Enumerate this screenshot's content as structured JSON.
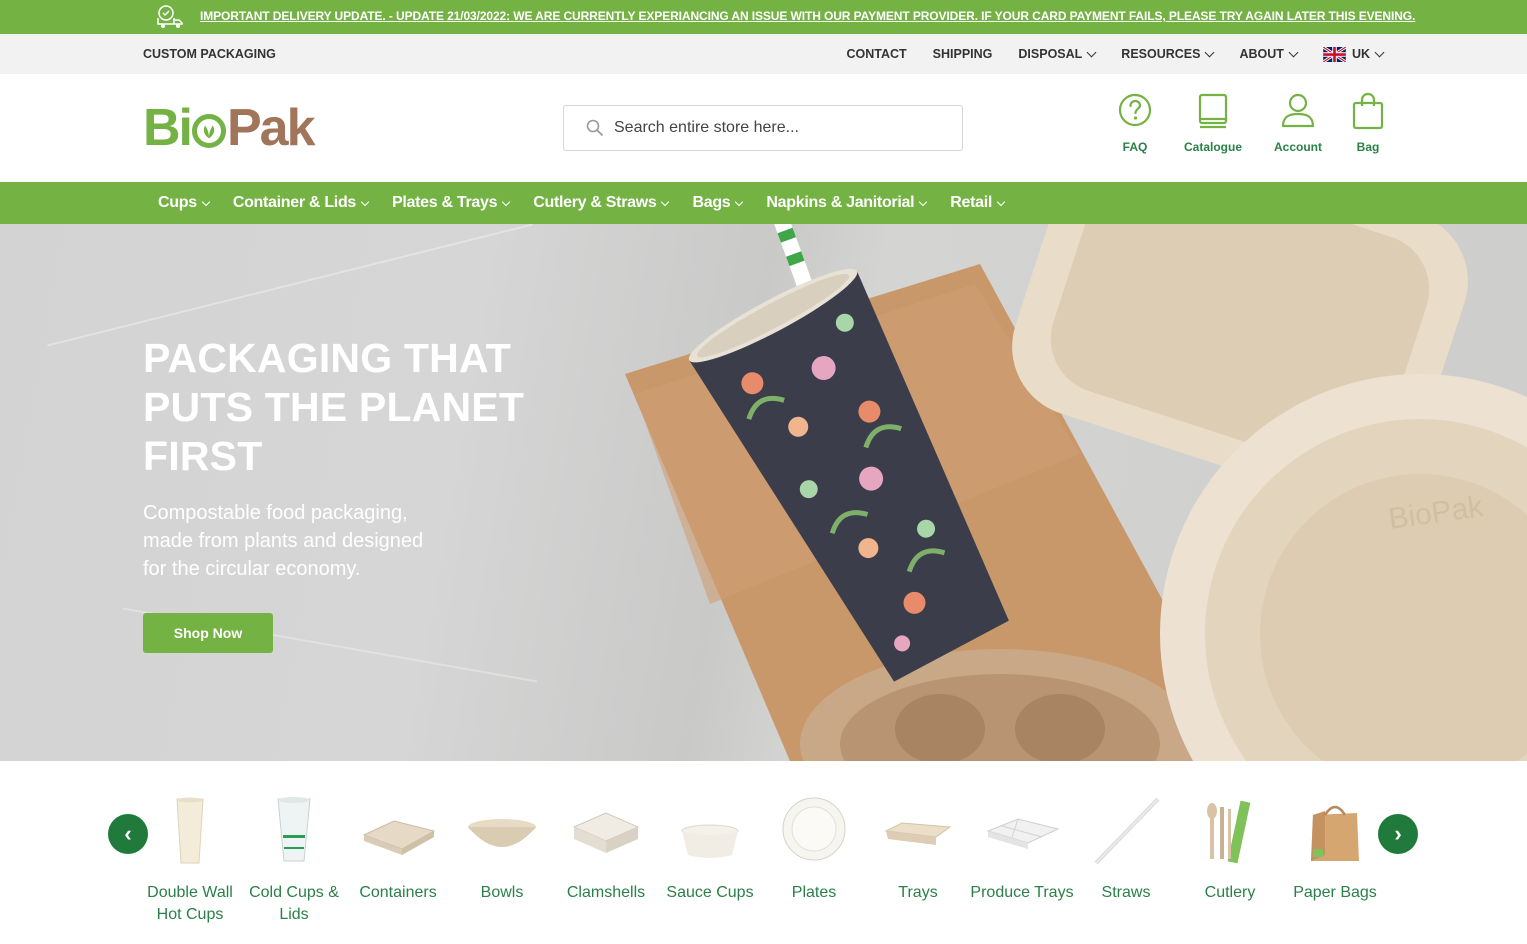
{
  "announcement": {
    "text": "IMPORTANT DELIVERY UPDATE. - UPDATE 21/03/2022: WE ARE CURRENTLY EXPERIANCING AN ISSUE WITH OUR PAYMENT PROVIDER. IF YOUR CARD PAYMENT FAILS, PLEASE TRY AGAIN LATER THIS EVENING.",
    "icon": "delivery-truck-icon"
  },
  "utility": {
    "custom_packaging": "CUSTOM PACKAGING",
    "links": [
      "CONTACT",
      "SHIPPING",
      "DISPOSAL",
      "RESOURCES",
      "ABOUT"
    ],
    "region": "UK"
  },
  "header": {
    "logo_left": "Bi",
    "logo_right": "Pak",
    "search_placeholder": "Search entire store here...",
    "icons": [
      {
        "label": "FAQ",
        "icon": "question-circle-icon"
      },
      {
        "label": "Catalogue",
        "icon": "book-icon"
      },
      {
        "label": "Account",
        "icon": "user-icon"
      },
      {
        "label": "Bag",
        "icon": "shopping-bag-icon"
      }
    ]
  },
  "categories": [
    "Cups",
    "Container & Lids",
    "Plates & Trays",
    "Cutlery & Straws",
    "Bags",
    "Napkins & Janitorial",
    "Retail"
  ],
  "hero": {
    "title": "PACKAGING THAT PUTS THE PLANET FIRST",
    "subtitle": "Compostable food packaging, made from plants and designed for the circular economy.",
    "button": "Shop Now"
  },
  "carousel": {
    "prev": "‹",
    "next": "›",
    "items": [
      "Double Wall Hot Cups",
      "Cold Cups & Lids",
      "Containers",
      "Bowls",
      "Clamshells",
      "Sauce Cups",
      "Plates",
      "Trays",
      "Produce Trays",
      "Straws",
      "Cutlery",
      "Paper Bags"
    ]
  },
  "colors": {
    "brand_green": "#74b244",
    "dark_green": "#1f7a3b",
    "link_green": "#2a8048",
    "brand_brown": "#a0755a"
  }
}
